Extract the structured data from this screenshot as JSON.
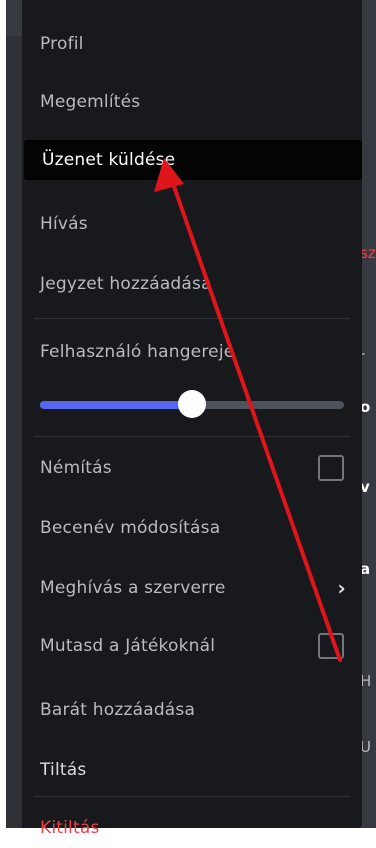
{
  "menu": {
    "items": [
      {
        "label": "Profil"
      },
      {
        "label": "Megemlítés"
      },
      {
        "label": "Üzenet küldése"
      },
      {
        "label": "Hívás"
      },
      {
        "label": "Jegyzet hozzáadása"
      },
      {
        "label": "Felhasználó hangereje"
      },
      {
        "label": "Némítás"
      },
      {
        "label": "Becenév módosítása"
      },
      {
        "label": "Meghívás a szerverre"
      },
      {
        "label": "Mutasd a Játékoknál"
      },
      {
        "label": "Barát hozzáadása"
      },
      {
        "label": "Tiltás"
      },
      {
        "label": "Kitiltás"
      }
    ],
    "volume": {
      "value": 0.5
    }
  },
  "background": {
    "fragments": [
      "sz",
      "-",
      "o",
      "v",
      "a",
      "H",
      "U"
    ]
  },
  "annotation": {
    "arrow_color": "#e0151b"
  },
  "colors": {
    "menu_bg": "#18191c",
    "slider_fill": "#5865f2",
    "danger": "#ed4245"
  }
}
